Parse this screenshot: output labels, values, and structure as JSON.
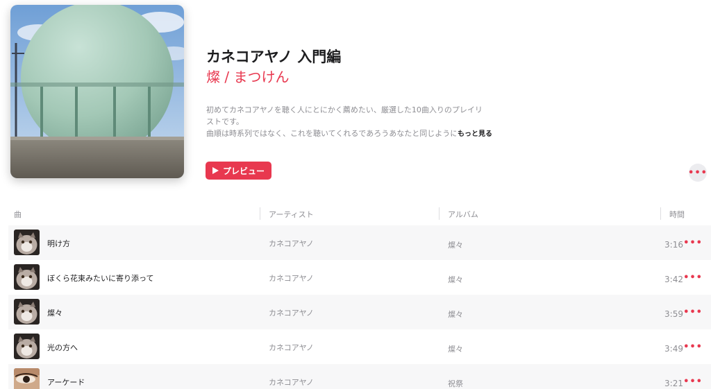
{
  "playlist": {
    "title": "カネコアヤノ 入門編",
    "curator": "燦 / まつけん",
    "description_line1": "初めてカネコアヤノを聴く人にとにかく薦めたい、厳選した10曲入りのプレイリ",
    "description_line2": "ストです。",
    "description_line3": "曲順は時系列ではなく、これを聴いてくれるであろうあなたと同じように",
    "more_label": "もっと見る",
    "preview_label": "プレビュー",
    "artwork_icon": "gas-holder-tank-artwork"
  },
  "table": {
    "headers": {
      "song": "曲",
      "artist": "アーティスト",
      "album": "アルバム",
      "duration": "時間"
    },
    "rows": [
      {
        "song": "明け方",
        "artist": "カネコアヤノ",
        "album": "燦々",
        "duration": "3:16",
        "thumb": "cat-thumbnail"
      },
      {
        "song": "ぼくら花束みたいに寄り添って",
        "artist": "カネコアヤノ",
        "album": "燦々",
        "duration": "3:42",
        "thumb": "cat-thumbnail"
      },
      {
        "song": "燦々",
        "artist": "カネコアヤノ",
        "album": "燦々",
        "duration": "3:59",
        "thumb": "cat-thumbnail"
      },
      {
        "song": "光の方へ",
        "artist": "カネコアヤノ",
        "album": "燦々",
        "duration": "3:49",
        "thumb": "cat-thumbnail"
      },
      {
        "song": "アーケード",
        "artist": "カネコアヤノ",
        "album": "祝祭",
        "duration": "3:21",
        "thumb": "eye-closeup-thumbnail"
      }
    ]
  },
  "colors": {
    "accent": "#e8384f",
    "secondary_text": "#8e8e93",
    "row_alt": "#f7f7f8"
  },
  "icons": {
    "more": "ellipsis-icon",
    "play": "play-icon"
  }
}
